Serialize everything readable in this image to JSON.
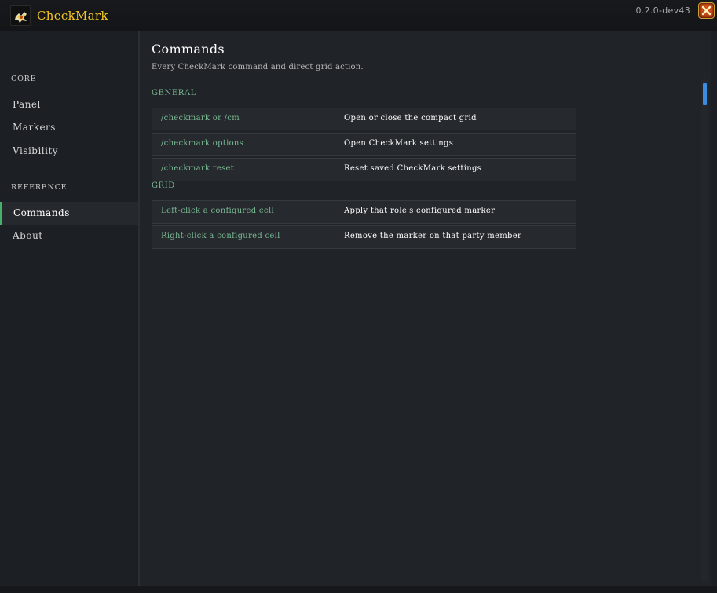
{
  "app": {
    "title": "CheckMark",
    "version": "0.2.0-dev43",
    "close_icon": "close-x-icon",
    "logo_icon": "checkmark-logo-icon"
  },
  "colors": {
    "title_gold": "#f2c624",
    "accent_green": "#46b06a",
    "command_green": "#79b892",
    "scroll_blue": "#3a8de0",
    "close_orange": "#e05a1c"
  },
  "sidebar": {
    "sections": [
      {
        "title": "CORE",
        "items": [
          "Panel",
          "Markers",
          "Visibility"
        ]
      },
      {
        "title": "REFERENCE",
        "items": [
          "Commands",
          "About"
        ]
      }
    ],
    "active_item": "Commands"
  },
  "main": {
    "title": "Commands",
    "subtitle": "Every CheckMark command and direct grid action.",
    "groups": [
      {
        "title": "GENERAL",
        "rows": [
          {
            "command": "/checkmark or /cm",
            "description": "Open or close the compact grid"
          },
          {
            "command": "/checkmark options",
            "description": "Open CheckMark settings"
          },
          {
            "command": "/checkmark reset",
            "description": "Reset saved CheckMark settings"
          }
        ]
      },
      {
        "title": "GRID",
        "rows": [
          {
            "command": "Left-click a configured cell",
            "description": "Apply that role's configured marker"
          },
          {
            "command": "Right-click a configured cell",
            "description": "Remove the marker on that party member"
          }
        ]
      }
    ]
  },
  "scrollbar": {
    "position_fraction": 0.0
  }
}
